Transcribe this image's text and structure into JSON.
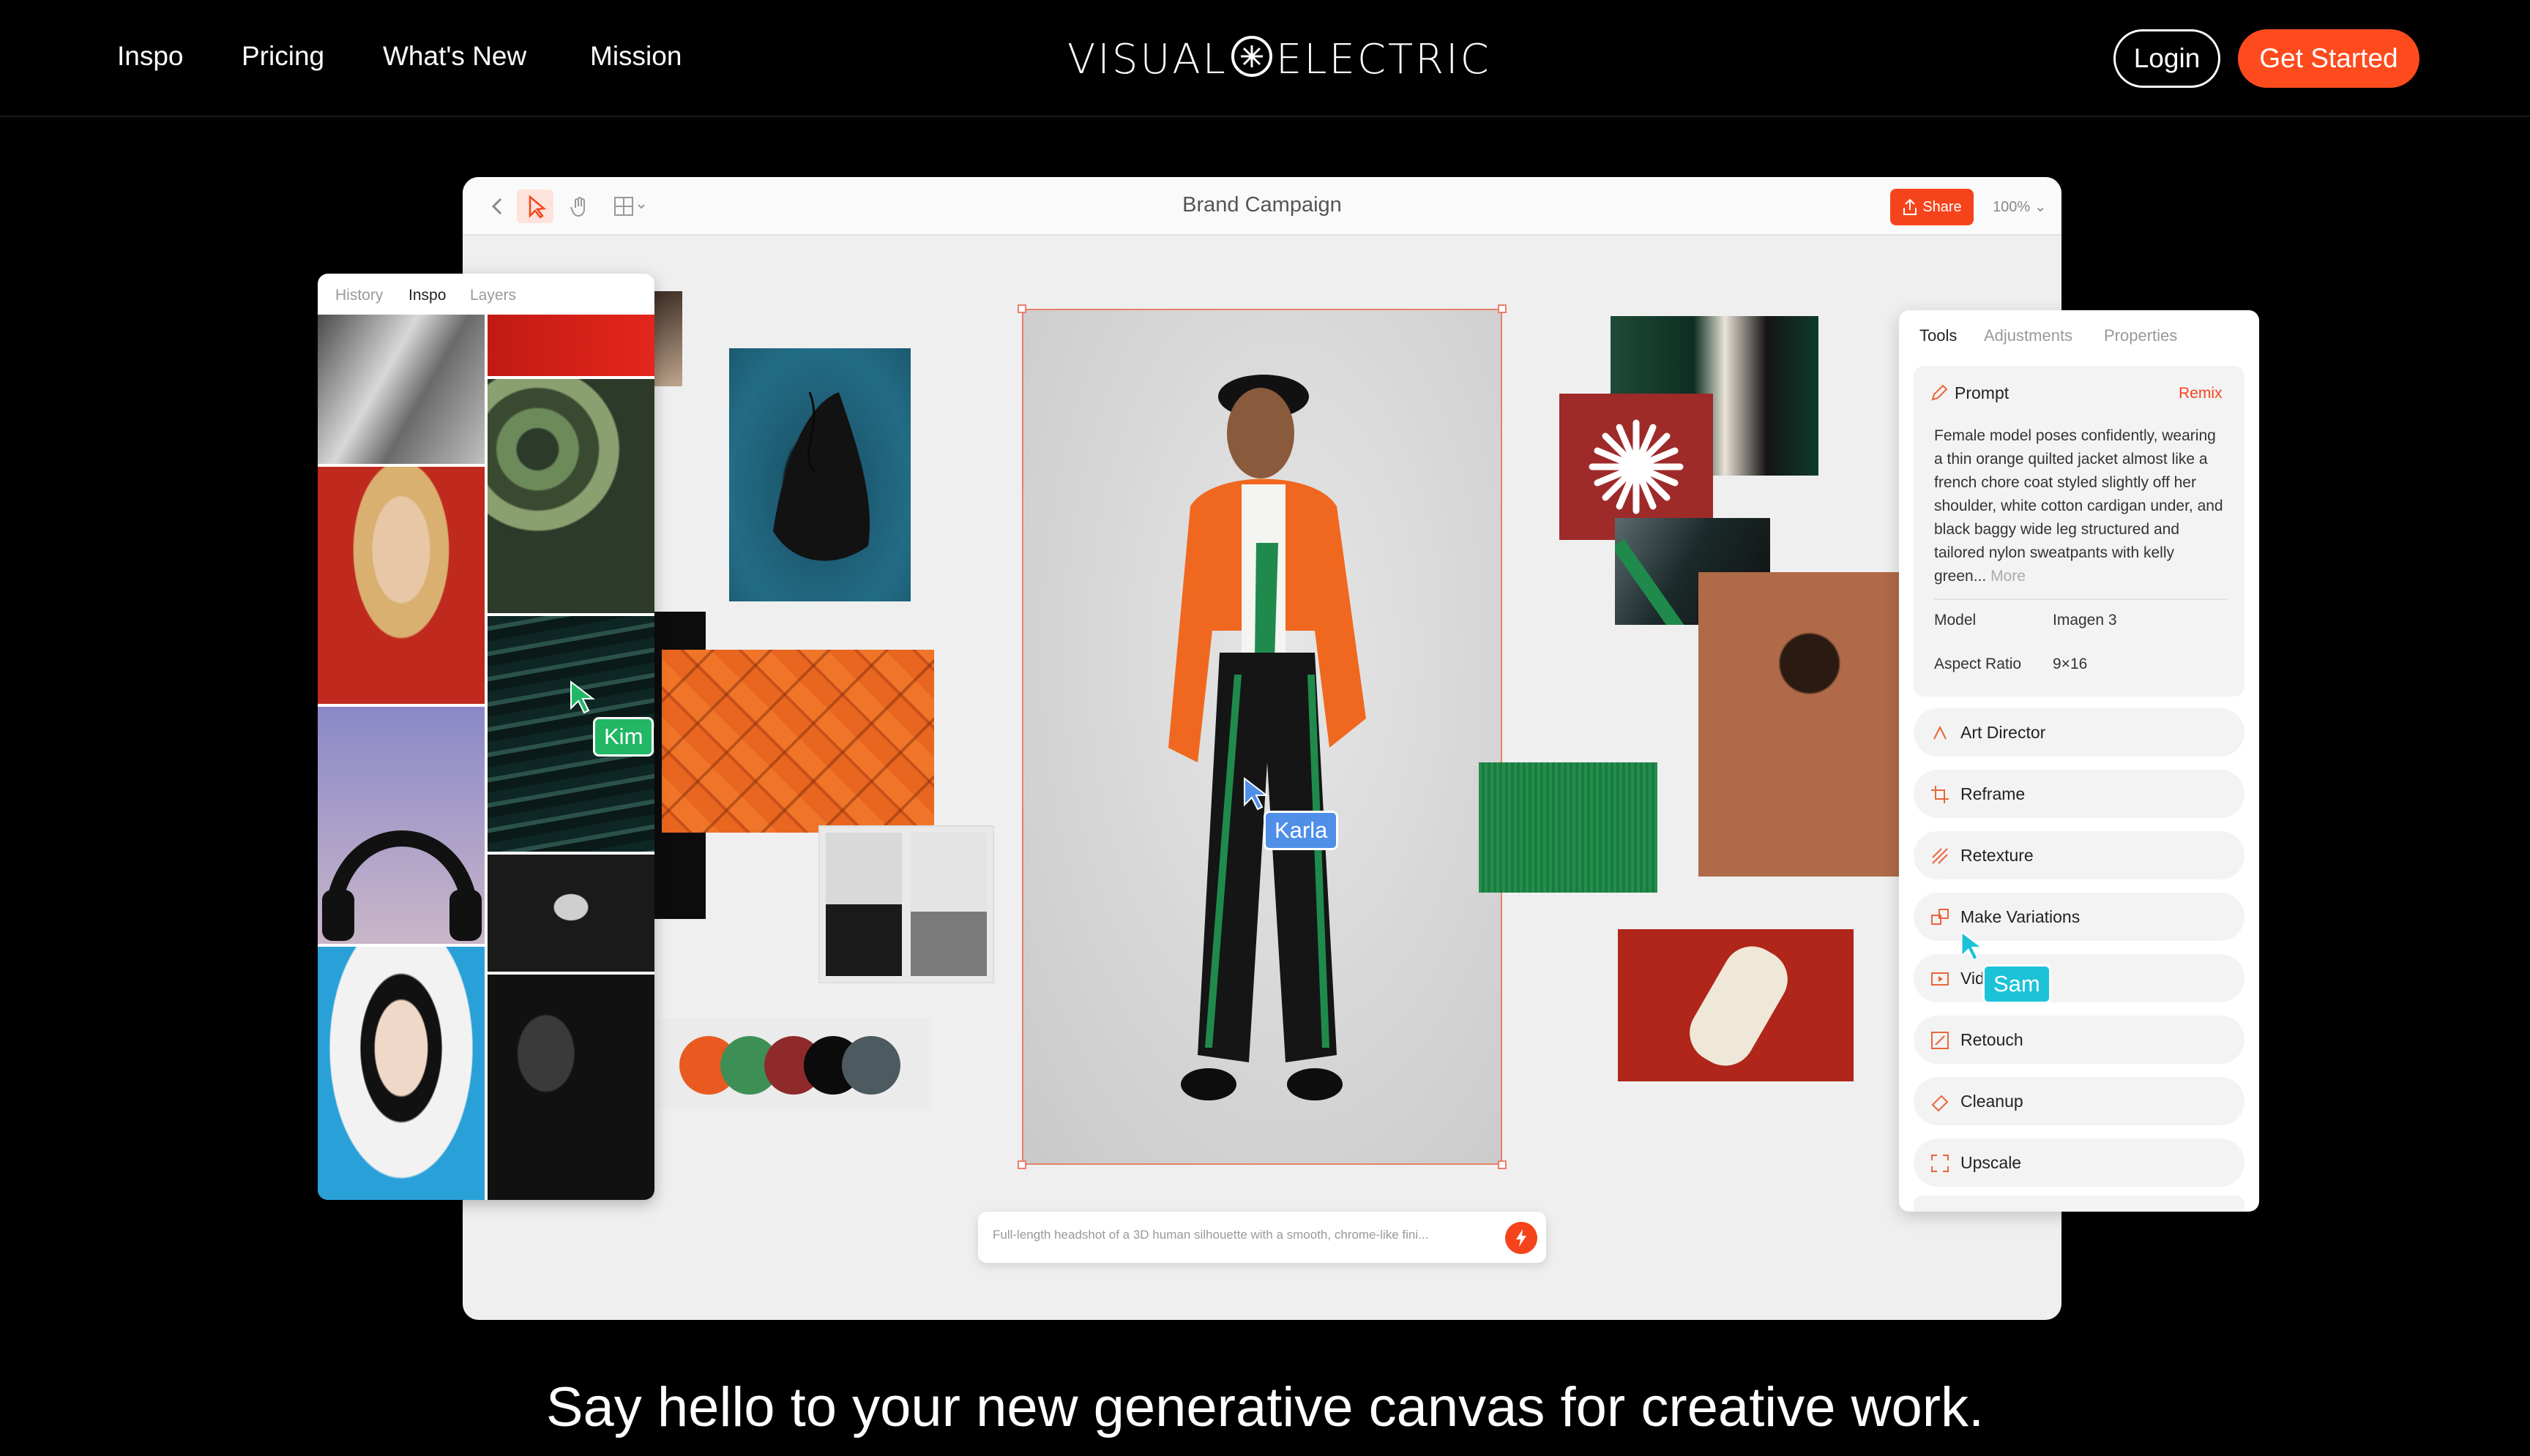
{
  "nav": {
    "links": [
      "Inspo",
      "Pricing",
      "What's New",
      "Mission"
    ],
    "logo": "VISUAL ELECTRIC",
    "login": "Login",
    "get_started": "Get Started"
  },
  "app": {
    "title": "Brand Campaign",
    "share": "Share",
    "zoom": "100%",
    "left_tabs": [
      "History",
      "Inspo",
      "Layers"
    ],
    "right_tabs": [
      "Tools",
      "Adjustments",
      "Properties"
    ],
    "prompt": {
      "label": "Prompt",
      "remix": "Remix",
      "text": "Female model poses confidently, wearing a thin orange quilted jacket almost like a french chore coat styled slightly off her shoulder, white cotton cardigan under, and black baggy wide leg structured and tailored nylon sweatpants with kelly green...",
      "more": "More",
      "model_label": "Model",
      "model_value": "Imagen 3",
      "aspect_label": "Aspect Ratio",
      "aspect_value": "9×16"
    },
    "tools": [
      "Art Director",
      "Reframe",
      "Retexture",
      "Make Variations",
      "Vid",
      "Retouch",
      "Cleanup",
      "Upscale"
    ],
    "cursors": {
      "kim": "Kim",
      "karla": "Karla",
      "sam": "Sam"
    },
    "prompt_bar_placeholder": "Full-length headshot of a 3D human silhouette with a smooth, chrome-like fini..."
  },
  "palette": [
    "#e85a1f",
    "#3d8f56",
    "#8e2a2a",
    "#0b0b0b",
    "#4d5a60"
  ],
  "colors": {
    "accent": "#fe4b1e",
    "kim": "#22b765",
    "karla": "#4f8fe8",
    "sam": "#1cc3d8"
  },
  "headline": "Say hello to your new generative canvas for creative work."
}
